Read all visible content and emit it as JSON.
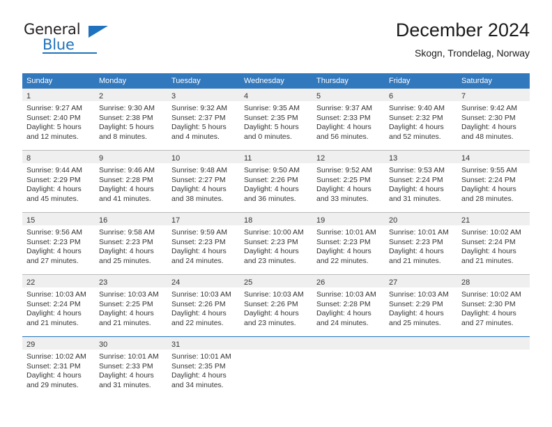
{
  "logo": {
    "word_top": "General",
    "word_bottom": "Blue",
    "triangle_icon": "triangle-icon",
    "brand_color": "#1f72bd"
  },
  "header": {
    "title": "December 2024",
    "subtitle": "Skogn, Trondelag, Norway"
  },
  "calendar": {
    "header_bg": "#3278bd",
    "daynum_band_bg": "#efefef",
    "weekday_headers": [
      "Sunday",
      "Monday",
      "Tuesday",
      "Wednesday",
      "Thursday",
      "Friday",
      "Saturday"
    ],
    "weeks": [
      [
        {
          "day": "1",
          "sunrise": "Sunrise: 9:27 AM",
          "sunset": "Sunset: 2:40 PM",
          "daylight_line1": "Daylight: 5 hours",
          "daylight_line2": "and 12 minutes."
        },
        {
          "day": "2",
          "sunrise": "Sunrise: 9:30 AM",
          "sunset": "Sunset: 2:38 PM",
          "daylight_line1": "Daylight: 5 hours",
          "daylight_line2": "and 8 minutes."
        },
        {
          "day": "3",
          "sunrise": "Sunrise: 9:32 AM",
          "sunset": "Sunset: 2:37 PM",
          "daylight_line1": "Daylight: 5 hours",
          "daylight_line2": "and 4 minutes."
        },
        {
          "day": "4",
          "sunrise": "Sunrise: 9:35 AM",
          "sunset": "Sunset: 2:35 PM",
          "daylight_line1": "Daylight: 5 hours",
          "daylight_line2": "and 0 minutes."
        },
        {
          "day": "5",
          "sunrise": "Sunrise: 9:37 AM",
          "sunset": "Sunset: 2:33 PM",
          "daylight_line1": "Daylight: 4 hours",
          "daylight_line2": "and 56 minutes."
        },
        {
          "day": "6",
          "sunrise": "Sunrise: 9:40 AM",
          "sunset": "Sunset: 2:32 PM",
          "daylight_line1": "Daylight: 4 hours",
          "daylight_line2": "and 52 minutes."
        },
        {
          "day": "7",
          "sunrise": "Sunrise: 9:42 AM",
          "sunset": "Sunset: 2:30 PM",
          "daylight_line1": "Daylight: 4 hours",
          "daylight_line2": "and 48 minutes."
        }
      ],
      [
        {
          "day": "8",
          "sunrise": "Sunrise: 9:44 AM",
          "sunset": "Sunset: 2:29 PM",
          "daylight_line1": "Daylight: 4 hours",
          "daylight_line2": "and 45 minutes."
        },
        {
          "day": "9",
          "sunrise": "Sunrise: 9:46 AM",
          "sunset": "Sunset: 2:28 PM",
          "daylight_line1": "Daylight: 4 hours",
          "daylight_line2": "and 41 minutes."
        },
        {
          "day": "10",
          "sunrise": "Sunrise: 9:48 AM",
          "sunset": "Sunset: 2:27 PM",
          "daylight_line1": "Daylight: 4 hours",
          "daylight_line2": "and 38 minutes."
        },
        {
          "day": "11",
          "sunrise": "Sunrise: 9:50 AM",
          "sunset": "Sunset: 2:26 PM",
          "daylight_line1": "Daylight: 4 hours",
          "daylight_line2": "and 36 minutes."
        },
        {
          "day": "12",
          "sunrise": "Sunrise: 9:52 AM",
          "sunset": "Sunset: 2:25 PM",
          "daylight_line1": "Daylight: 4 hours",
          "daylight_line2": "and 33 minutes."
        },
        {
          "day": "13",
          "sunrise": "Sunrise: 9:53 AM",
          "sunset": "Sunset: 2:24 PM",
          "daylight_line1": "Daylight: 4 hours",
          "daylight_line2": "and 31 minutes."
        },
        {
          "day": "14",
          "sunrise": "Sunrise: 9:55 AM",
          "sunset": "Sunset: 2:24 PM",
          "daylight_line1": "Daylight: 4 hours",
          "daylight_line2": "and 28 minutes."
        }
      ],
      [
        {
          "day": "15",
          "sunrise": "Sunrise: 9:56 AM",
          "sunset": "Sunset: 2:23 PM",
          "daylight_line1": "Daylight: 4 hours",
          "daylight_line2": "and 27 minutes."
        },
        {
          "day": "16",
          "sunrise": "Sunrise: 9:58 AM",
          "sunset": "Sunset: 2:23 PM",
          "daylight_line1": "Daylight: 4 hours",
          "daylight_line2": "and 25 minutes."
        },
        {
          "day": "17",
          "sunrise": "Sunrise: 9:59 AM",
          "sunset": "Sunset: 2:23 PM",
          "daylight_line1": "Daylight: 4 hours",
          "daylight_line2": "and 24 minutes."
        },
        {
          "day": "18",
          "sunrise": "Sunrise: 10:00 AM",
          "sunset": "Sunset: 2:23 PM",
          "daylight_line1": "Daylight: 4 hours",
          "daylight_line2": "and 23 minutes."
        },
        {
          "day": "19",
          "sunrise": "Sunrise: 10:01 AM",
          "sunset": "Sunset: 2:23 PM",
          "daylight_line1": "Daylight: 4 hours",
          "daylight_line2": "and 22 minutes."
        },
        {
          "day": "20",
          "sunrise": "Sunrise: 10:01 AM",
          "sunset": "Sunset: 2:23 PM",
          "daylight_line1": "Daylight: 4 hours",
          "daylight_line2": "and 21 minutes."
        },
        {
          "day": "21",
          "sunrise": "Sunrise: 10:02 AM",
          "sunset": "Sunset: 2:24 PM",
          "daylight_line1": "Daylight: 4 hours",
          "daylight_line2": "and 21 minutes."
        }
      ],
      [
        {
          "day": "22",
          "sunrise": "Sunrise: 10:03 AM",
          "sunset": "Sunset: 2:24 PM",
          "daylight_line1": "Daylight: 4 hours",
          "daylight_line2": "and 21 minutes."
        },
        {
          "day": "23",
          "sunrise": "Sunrise: 10:03 AM",
          "sunset": "Sunset: 2:25 PM",
          "daylight_line1": "Daylight: 4 hours",
          "daylight_line2": "and 21 minutes."
        },
        {
          "day": "24",
          "sunrise": "Sunrise: 10:03 AM",
          "sunset": "Sunset: 2:26 PM",
          "daylight_line1": "Daylight: 4 hours",
          "daylight_line2": "and 22 minutes."
        },
        {
          "day": "25",
          "sunrise": "Sunrise: 10:03 AM",
          "sunset": "Sunset: 2:26 PM",
          "daylight_line1": "Daylight: 4 hours",
          "daylight_line2": "and 23 minutes."
        },
        {
          "day": "26",
          "sunrise": "Sunrise: 10:03 AM",
          "sunset": "Sunset: 2:28 PM",
          "daylight_line1": "Daylight: 4 hours",
          "daylight_line2": "and 24 minutes."
        },
        {
          "day": "27",
          "sunrise": "Sunrise: 10:03 AM",
          "sunset": "Sunset: 2:29 PM",
          "daylight_line1": "Daylight: 4 hours",
          "daylight_line2": "and 25 minutes."
        },
        {
          "day": "28",
          "sunrise": "Sunrise: 10:02 AM",
          "sunset": "Sunset: 2:30 PM",
          "daylight_line1": "Daylight: 4 hours",
          "daylight_line2": "and 27 minutes."
        }
      ],
      [
        {
          "day": "29",
          "sunrise": "Sunrise: 10:02 AM",
          "sunset": "Sunset: 2:31 PM",
          "daylight_line1": "Daylight: 4 hours",
          "daylight_line2": "and 29 minutes."
        },
        {
          "day": "30",
          "sunrise": "Sunrise: 10:01 AM",
          "sunset": "Sunset: 2:33 PM",
          "daylight_line1": "Daylight: 4 hours",
          "daylight_line2": "and 31 minutes."
        },
        {
          "day": "31",
          "sunrise": "Sunrise: 10:01 AM",
          "sunset": "Sunset: 2:35 PM",
          "daylight_line1": "Daylight: 4 hours",
          "daylight_line2": "and 34 minutes."
        },
        {
          "day": "",
          "sunrise": "",
          "sunset": "",
          "daylight_line1": "",
          "daylight_line2": ""
        },
        {
          "day": "",
          "sunrise": "",
          "sunset": "",
          "daylight_line1": "",
          "daylight_line2": ""
        },
        {
          "day": "",
          "sunrise": "",
          "sunset": "",
          "daylight_line1": "",
          "daylight_line2": ""
        },
        {
          "day": "",
          "sunrise": "",
          "sunset": "",
          "daylight_line1": "",
          "daylight_line2": ""
        }
      ]
    ]
  }
}
